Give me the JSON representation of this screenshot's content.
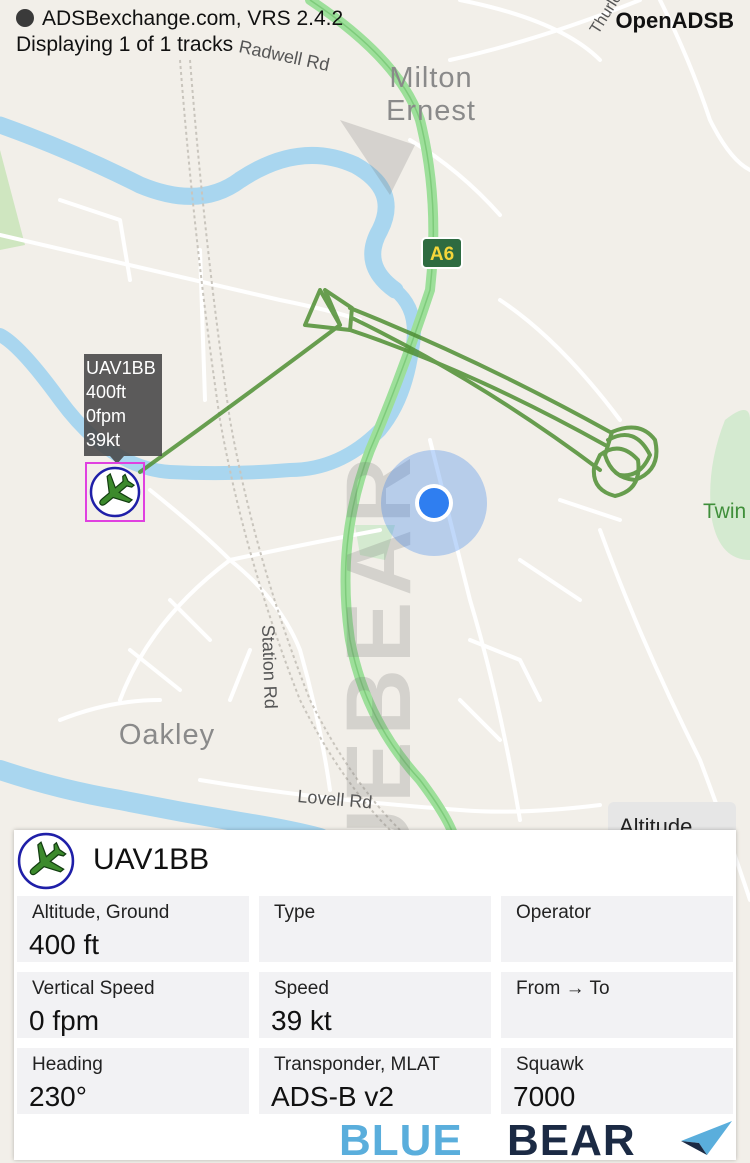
{
  "status": {
    "source": "ADSBexchange.com, VRS 2.4.2",
    "tracks": "Displaying 1 of 1 tracks"
  },
  "brand_top": "OpenADSB",
  "map": {
    "place_labels": [
      "Milton",
      "Ernest",
      "Oakley",
      "Twin"
    ],
    "road_labels": [
      "Radwell Rd",
      "Station Rd",
      "Lovell Rd",
      "Thurleigh Rd"
    ],
    "road_shield": "A6",
    "colors": {
      "land": "#f2efe9",
      "water": "#a9d6ef",
      "major_road": "#9ddf9a",
      "track": "#4f8f34",
      "location": "#2f7ef0"
    }
  },
  "aircraft_tag": {
    "callsign": "UAV1BB",
    "altitude": "400ft",
    "vspeed": "0fpm",
    "speed": "39kt",
    "icon": "aircraft-icon"
  },
  "altitude_button": "Altitude",
  "watermark": "BLUEBEAR",
  "panel": {
    "callsign": "UAV1BB",
    "fields": [
      {
        "label": "Altitude, Ground",
        "value": "400 ft"
      },
      {
        "label": "Type",
        "value": ""
      },
      {
        "label": "Operator",
        "value": ""
      },
      {
        "label": "Vertical Speed",
        "value": "0 fpm"
      },
      {
        "label": "Speed",
        "value": "39 kt"
      },
      {
        "label": "From → To",
        "value": ""
      },
      {
        "label": "Heading",
        "value": "230°"
      },
      {
        "label": "Transponder, MLAT",
        "value": "ADS-B v2"
      },
      {
        "label": "Squawk",
        "value": "7000"
      }
    ],
    "logo": {
      "part1": "BLUE",
      "part2": "BEAR"
    }
  }
}
